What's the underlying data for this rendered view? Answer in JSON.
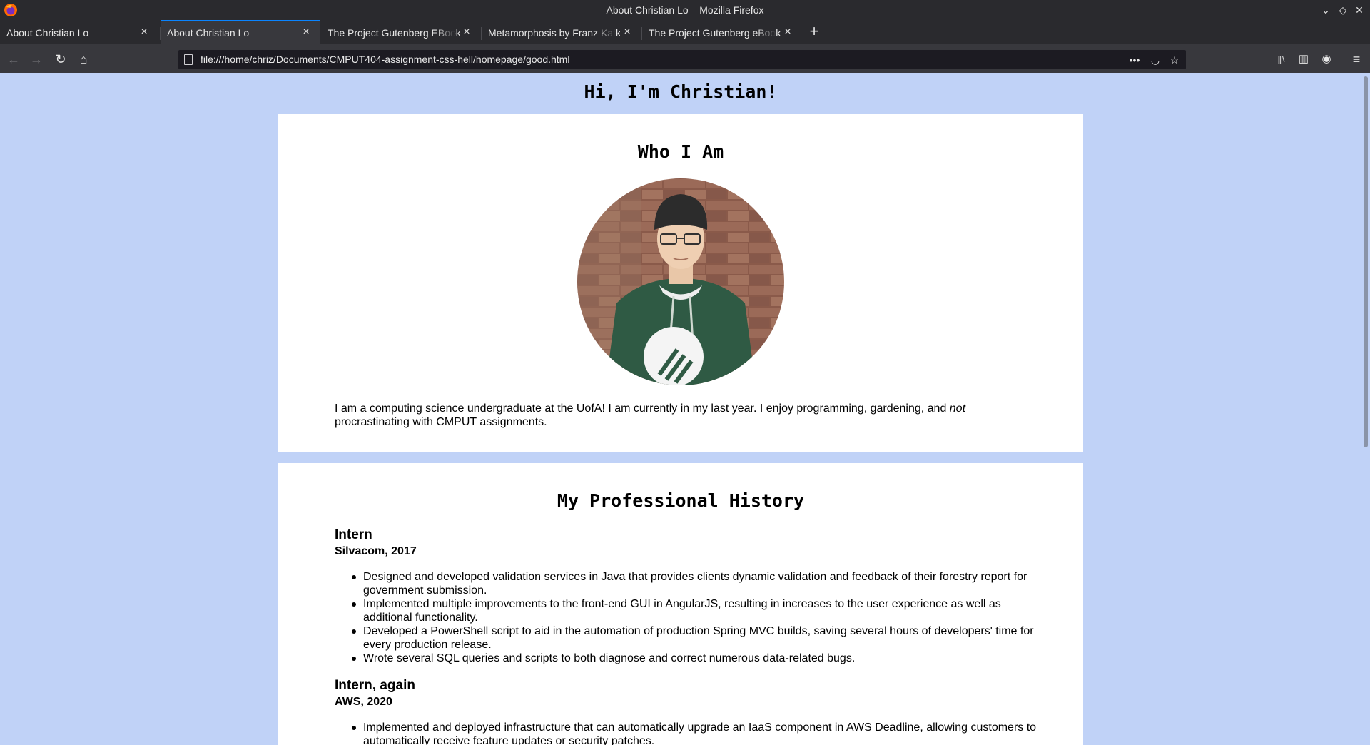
{
  "window": {
    "title": "About Christian Lo – Mozilla Firefox",
    "controls": {
      "minimize": "⌄",
      "restore": "◇",
      "close": "✕"
    }
  },
  "tabs": [
    {
      "label": "About Christian Lo",
      "active": false
    },
    {
      "label": "About Christian Lo",
      "active": true
    },
    {
      "label": "The Project Gutenberg EBook",
      "active": false
    },
    {
      "label": "Metamorphosis by Franz Kafka",
      "active": false
    },
    {
      "label": "The Project Gutenberg eBook",
      "active": false
    }
  ],
  "toolbar": {
    "back_icon": "←",
    "forward_icon": "→",
    "reload_icon": "↻",
    "home_icon": "⌂",
    "new_tab_icon": "+",
    "url": "file:///home/chriz/Documents/CMPUT404-assignment-css-hell/homepage/good.html",
    "page_actions_icon": "•••",
    "pocket_icon": "◡",
    "bookmark_icon": "☆",
    "library_icon": "|||\\",
    "sidebar_icon": "▥",
    "account_icon": "◉",
    "menu_icon": "≡"
  },
  "page": {
    "heading": "Hi, I'm Christian!",
    "who": {
      "heading": "Who I Am",
      "bio_before": "I am a computing science undergraduate at the UofA! I am currently in my last year. I enjoy programming, gardening, and ",
      "bio_emphasis": "not",
      "bio_after": " procrastinating with CMPUT assignments."
    },
    "history": {
      "heading": "My Professional History",
      "jobs": [
        {
          "title": "Intern",
          "meta": "Silvacom, 2017",
          "bullets": [
            "Designed and developed validation services in Java that provides clients dynamic validation and feedback of their forestry report for government submission.",
            "Implemented multiple improvements to the front-end GUI in AngularJS, resulting in increases to the user experience as well as additional functionality.",
            "Developed a PowerShell script to aid in the automation of production Spring MVC builds, saving several hours of developers' time for every production release.",
            "Wrote several SQL queries and scripts to both diagnose and correct numerous data-related bugs."
          ]
        },
        {
          "title": "Intern, again",
          "meta": "AWS, 2020",
          "bullets": [
            "Implemented and deployed infrastructure that can automatically upgrade an IaaS component in AWS Deadline, allowing customers to automatically receive feature updates or security patches."
          ]
        }
      ]
    }
  },
  "colors": {
    "page_background": "#c0d2f7",
    "card_background": "#ffffff",
    "chrome_dark": "#2a2a2e",
    "tab_active_accent": "#0a84ff"
  }
}
